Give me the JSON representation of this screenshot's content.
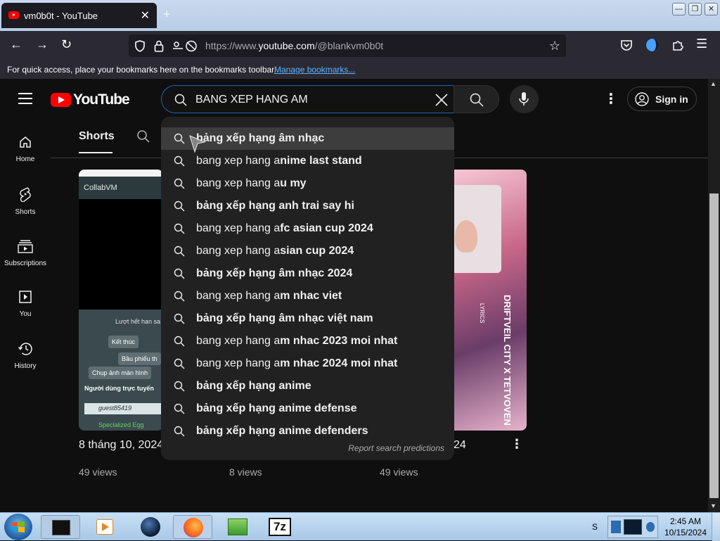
{
  "browser": {
    "tab_title": "vm0b0t - YouTube",
    "tab_close": "✕",
    "new_tab": "+",
    "url_prefix": "https://www.",
    "url_host": "youtube.com",
    "url_path": "/@blankvm0b0t",
    "bookmarks_hint": "For quick access, place your bookmarks here on the bookmarks toolbar.",
    "manage_bookmarks": "Manage bookmarks..."
  },
  "youtube": {
    "logo_text": "YouTube",
    "search_value": "BANG XEP HANG AM",
    "sign_in": "Sign in",
    "sidebar": [
      {
        "label": "Home",
        "icon": "home-icon"
      },
      {
        "label": "Shorts",
        "icon": "shorts-icon"
      },
      {
        "label": "Subscriptions",
        "icon": "subscriptions-icon"
      },
      {
        "label": "You",
        "icon": "you-icon"
      },
      {
        "label": "History",
        "icon": "history-icon"
      }
    ],
    "channel_tab": "Shorts",
    "suggestions": [
      {
        "prefix": "",
        "rest": "bảng xếp hạng âm nhạc"
      },
      {
        "prefix": "bang xep hang a",
        "rest": "nime last stand"
      },
      {
        "prefix": "bang xep hang a",
        "rest": "u my"
      },
      {
        "prefix": "",
        "rest": "bảng xếp hạng anh trai say hi"
      },
      {
        "prefix": "bang xep hang a",
        "rest": "fc asian cup 2024"
      },
      {
        "prefix": "bang xep hang a",
        "rest": "sian cup 2024"
      },
      {
        "prefix": "",
        "rest": "bảng xếp hạng âm nhạc 2024"
      },
      {
        "prefix": "bang xep hang a",
        "rest": "m nhac viet"
      },
      {
        "prefix": "",
        "rest": "bảng xếp hạng âm nhạc việt nam"
      },
      {
        "prefix": "bang xep hang a",
        "rest": "m nhac 2023 moi nhat"
      },
      {
        "prefix": "bang xep hang a",
        "rest": "m nhac 2024 moi nhat"
      },
      {
        "prefix": "",
        "rest": "bảng xếp hạng anime"
      },
      {
        "prefix": "",
        "rest": "bảng xếp hạng anime defense"
      },
      {
        "prefix": "",
        "rest": "bảng xếp hạng anime defenders"
      }
    ],
    "report_predictions": "Report search predictions",
    "videos": [
      {
        "title": "8 tháng 10, 2024",
        "views": "49 views"
      },
      {
        "title": "",
        "views": "8 views"
      },
      {
        "title": "24",
        "views": "49 views"
      }
    ],
    "thumb1": {
      "header": "CollabVM",
      "line1": "Lượt hết han sa",
      "btn1": "Kết thúc",
      "btn2": "Bầu phiếu th",
      "btn3": "Chụp ảnh màn hình",
      "users": "Người dùng trực tuyến",
      "user1": "guest85419",
      "user2": "Specialized Egg"
    },
    "thumb3": {
      "title": "DRIFTVEIL CITY X TETVOVEN",
      "sub": "LYRICS"
    }
  },
  "taskbar": {
    "time": "2:45 AM",
    "date": "10/15/2024",
    "tray_letter": "S"
  },
  "colors": {
    "youtube_red": "#ff0000",
    "search_focus": "#1c62b9",
    "link_blue": "#5cb3ff"
  }
}
